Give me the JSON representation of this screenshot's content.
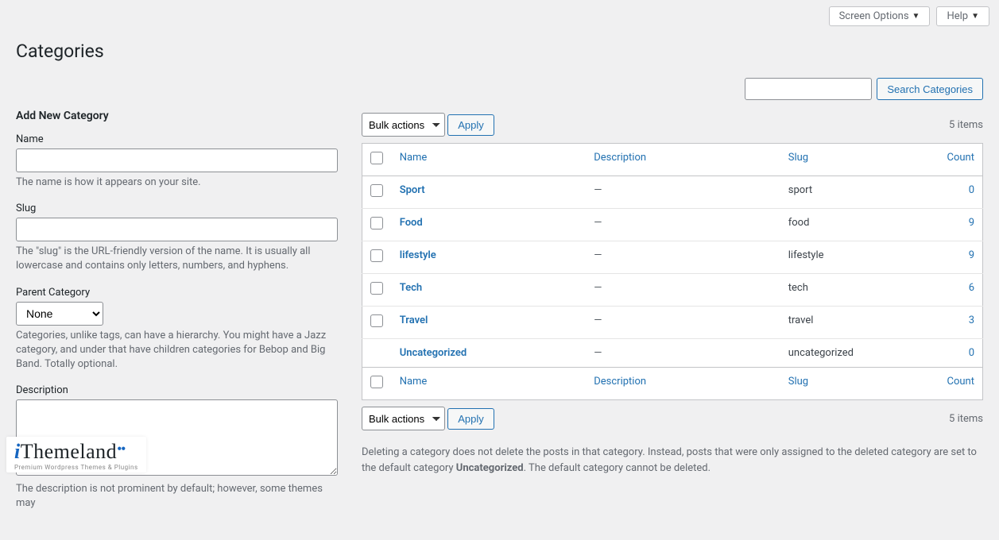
{
  "top": {
    "screen_options": "Screen Options",
    "help": "Help"
  },
  "page": {
    "title": "Categories",
    "search_button": "Search Categories"
  },
  "form": {
    "heading": "Add New Category",
    "name_label": "Name",
    "name_help": "The name is how it appears on your site.",
    "slug_label": "Slug",
    "slug_help": "The \"slug\" is the URL-friendly version of the name. It is usually all lowercase and contains only letters, numbers, and hyphens.",
    "parent_label": "Parent Category",
    "parent_selected": "None",
    "parent_help": "Categories, unlike tags, can have a hierarchy. You might have a Jazz category, and under that have children categories for Bebop and Big Band. Totally optional.",
    "desc_label": "Description",
    "desc_help": "The description is not prominent by default; however, some themes may"
  },
  "list": {
    "bulk_label": "Bulk actions",
    "apply_label": "Apply",
    "items_count": "5 items",
    "cols": {
      "name": "Name",
      "desc": "Description",
      "slug": "Slug",
      "count": "Count"
    },
    "rows": [
      {
        "name": "Sport",
        "desc": "—",
        "slug": "sport",
        "count": "0",
        "cb": true
      },
      {
        "name": "Food",
        "desc": "—",
        "slug": "food",
        "count": "9",
        "cb": true
      },
      {
        "name": "lifestyle",
        "desc": "—",
        "slug": "lifestyle",
        "count": "9",
        "cb": true
      },
      {
        "name": "Tech",
        "desc": "—",
        "slug": "tech",
        "count": "6",
        "cb": true
      },
      {
        "name": "Travel",
        "desc": "—",
        "slug": "travel",
        "count": "3",
        "cb": true
      },
      {
        "name": "Uncategorized",
        "desc": "—",
        "slug": "uncategorized",
        "count": "0",
        "cb": false
      }
    ],
    "delete_note_pre": "Deleting a category does not delete the posts in that category. Instead, posts that were only assigned to the deleted category are set to the default category ",
    "delete_note_bold": "Uncategorized",
    "delete_note_post": ". The default category cannot be deleted."
  },
  "logo": {
    "main_pre": "i",
    "main_rest": "Themeland",
    "sub": "Premium Wordpress Themes & Plugins"
  }
}
